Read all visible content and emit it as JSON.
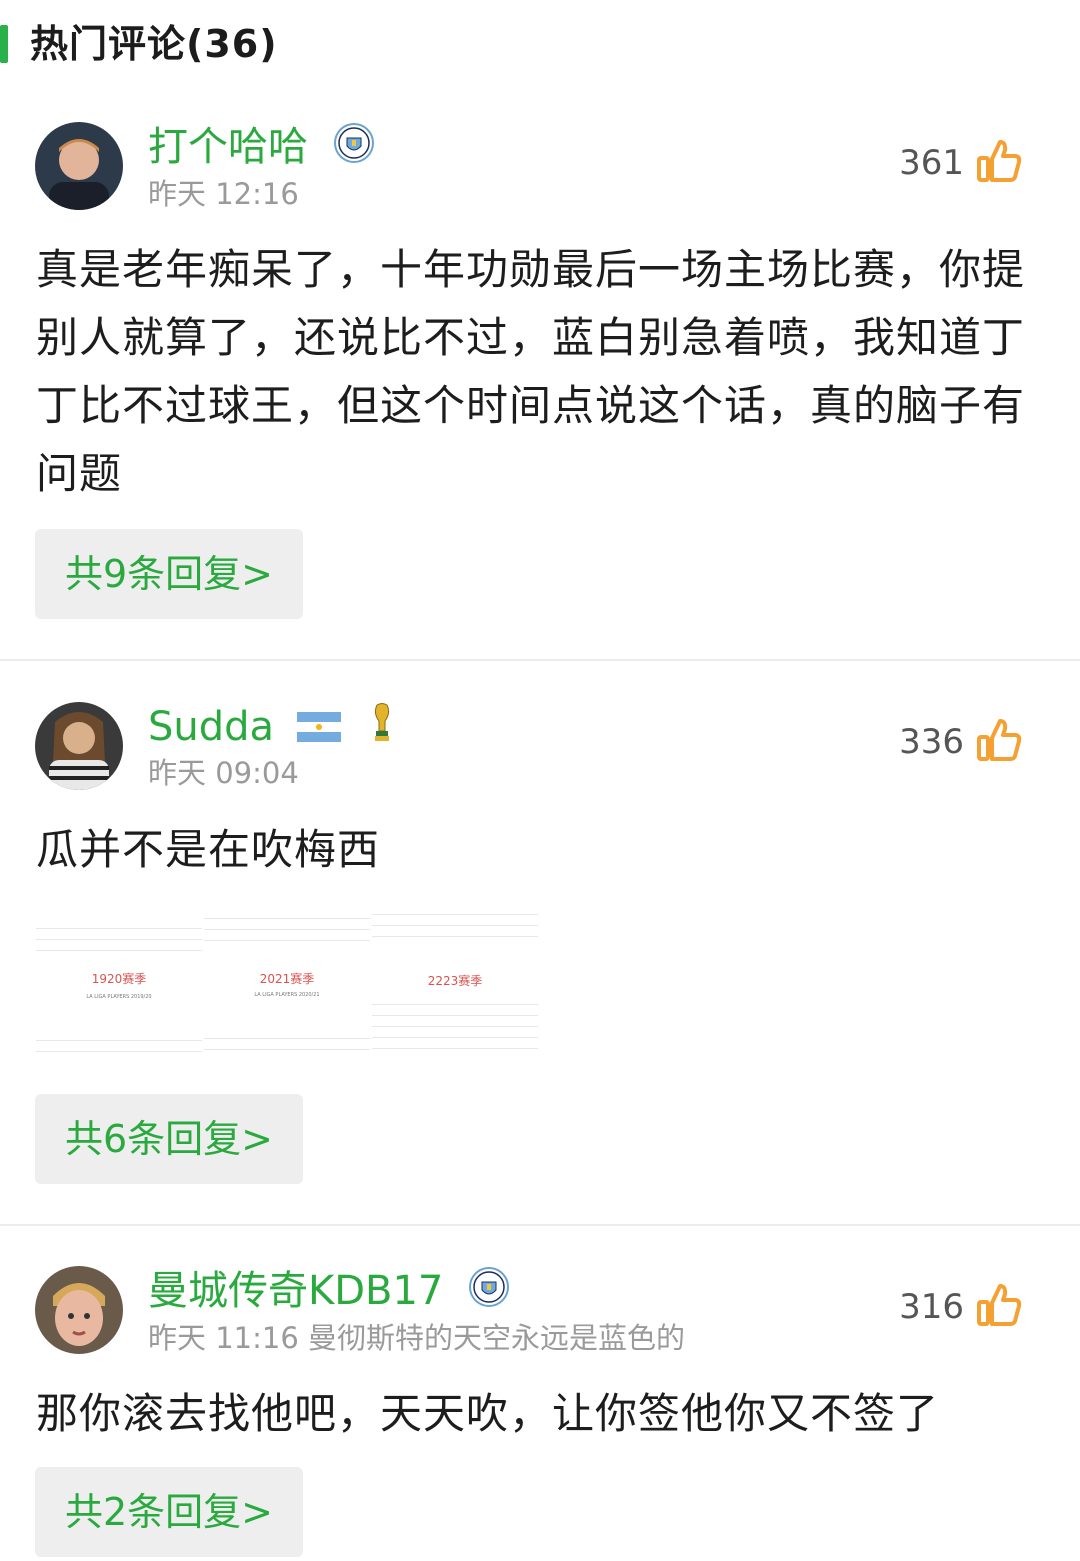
{
  "header": {
    "title": "热门评论(36)"
  },
  "comments": [
    {
      "username": "打个哈哈",
      "meta": "昨天 12:16",
      "likes": "361",
      "text": "真是老年痴呆了，十年功勋最后一场主场比赛，你提别人就算了，还说比不过，蓝白别急着喷，我知道丁丁比不过球王，但这个时间点说这个话，真的脑子有问题",
      "replies": "共9条回复>"
    },
    {
      "username": "Sudda",
      "meta": "昨天 09:04",
      "likes": "336",
      "text": "瓜并不是在吹梅西",
      "images": [
        {
          "caption": "1920赛季",
          "subtitle": "LA LIGA PLAYERS 2019/20"
        },
        {
          "caption": "2021赛季",
          "subtitle": "LA LIGA PLAYERS 2020/21"
        },
        {
          "caption": "2223赛季",
          "subtitle": ""
        }
      ],
      "replies": "共6条回复>"
    },
    {
      "username": "曼城传奇KDB17",
      "meta": "昨天 11:16 曼彻斯特的天空永远是蓝色的",
      "likes": "316",
      "text": "那你滚去找他吧，天天吹，让你签他你又不签了",
      "replies": "共2条回复>"
    }
  ],
  "icons": {
    "like": "thumbs-up-icon",
    "badge": "man-city-badge-icon",
    "flag": "argentina-flag-icon",
    "trophy": "world-cup-trophy-icon"
  },
  "colors": {
    "username": "#2aaa3e",
    "like": "#f5a033",
    "accent_bar": "#28b14a"
  }
}
